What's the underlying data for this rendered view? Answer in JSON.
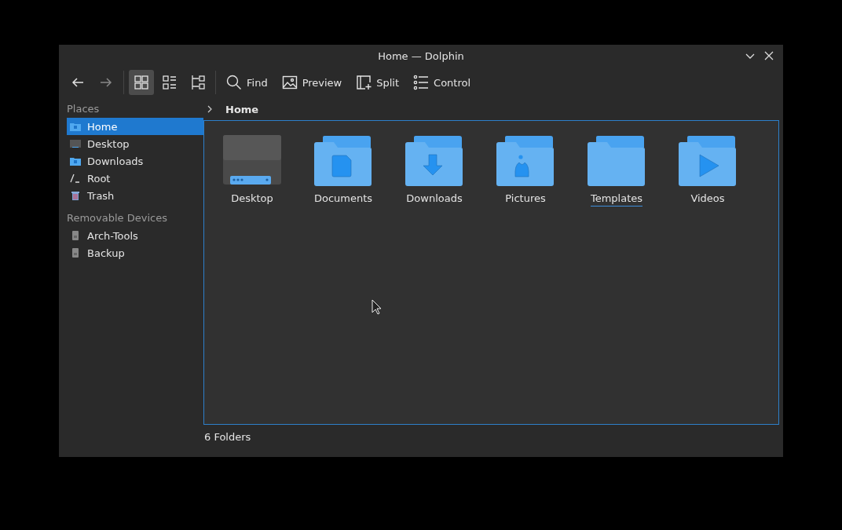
{
  "window": {
    "title": "Home — Dolphin"
  },
  "toolbar": {
    "back": {
      "disabled": false
    },
    "forward": {
      "disabled": true
    },
    "view_modes": [
      {
        "kind": "icons",
        "selected": true
      },
      {
        "kind": "compact",
        "selected": false
      },
      {
        "kind": "details",
        "selected": false
      }
    ],
    "actions": [
      {
        "kind": "find",
        "label": "Find"
      },
      {
        "kind": "preview",
        "label": "Preview"
      },
      {
        "kind": "split",
        "label": "Split"
      },
      {
        "kind": "control",
        "label": "Control"
      }
    ]
  },
  "sidebar": {
    "sections": [
      {
        "title": "Places",
        "items": [
          {
            "kind": "home",
            "label": "Home",
            "selected": true
          },
          {
            "kind": "desktop",
            "label": "Desktop",
            "selected": false
          },
          {
            "kind": "downloads",
            "label": "Downloads",
            "selected": false
          },
          {
            "kind": "root",
            "label": "Root",
            "selected": false
          },
          {
            "kind": "trash",
            "label": "Trash",
            "selected": false
          }
        ]
      },
      {
        "title": "Removable Devices",
        "items": [
          {
            "kind": "drive",
            "label": "Arch-Tools",
            "selected": false
          },
          {
            "kind": "drive",
            "label": "Backup",
            "selected": false
          }
        ]
      }
    ]
  },
  "breadcrumb": [
    "Home"
  ],
  "folders": [
    {
      "kind": "desktop",
      "label": "Desktop",
      "hovered": false
    },
    {
      "kind": "documents",
      "label": "Documents",
      "hovered": false
    },
    {
      "kind": "downloads",
      "label": "Downloads",
      "hovered": false
    },
    {
      "kind": "pictures",
      "label": "Pictures",
      "hovered": false
    },
    {
      "kind": "templates",
      "label": "Templates",
      "hovered": true
    },
    {
      "kind": "videos",
      "label": "Videos",
      "hovered": false
    }
  ],
  "status_bar": {
    "text": "6 Folders"
  }
}
